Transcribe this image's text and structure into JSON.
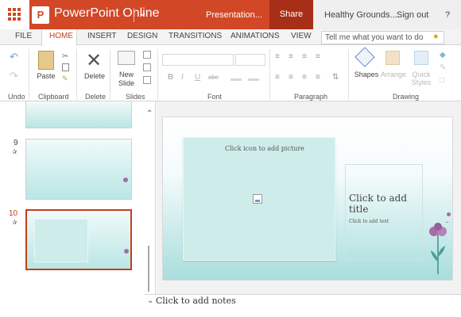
{
  "titlebar": {
    "app_title": "PowerPoint Online",
    "doc_name": "Presentation...",
    "share": "Share",
    "account": "Healthy Grounds...",
    "signout": "Sign out",
    "help": "?"
  },
  "tabs": [
    "FILE",
    "HOME",
    "INSERT",
    "DESIGN",
    "TRANSITIONS",
    "ANIMATIONS",
    "VIEW"
  ],
  "active_tab": "HOME",
  "tellme_placeholder": "Tell me what you want to do",
  "ribbon": {
    "undo_group": "Undo",
    "clipboard_group": "Clipboard",
    "paste": "Paste",
    "delete_group": "Delete",
    "delete": "Delete",
    "slides_group": "Slides",
    "new_slide_line1": "New",
    "new_slide_line2": "Slide",
    "font_group": "Font",
    "font_bold": "B",
    "font_italic": "I",
    "font_underline": "U",
    "font_strike": "abc",
    "paragraph_group": "Paragraph",
    "shapes": "Shapes",
    "arrange": "Arrange",
    "quick_styles_line1": "Quick",
    "quick_styles_line2": "Styles",
    "drawing_group": "Drawing"
  },
  "thumbnails": [
    {
      "number": "9",
      "selected": false
    },
    {
      "number": "10",
      "selected": true
    }
  ],
  "slide": {
    "picture_placeholder": "Click icon to add picture",
    "title_placeholder": "Click to add title",
    "subtitle_placeholder": "Click to add text"
  },
  "notes_placeholder": "Click to add notes",
  "colors": {
    "accent": "#d24726",
    "share_bg": "#a82f17",
    "slide_teal": "#bfe7e6",
    "selected_border": "#c43e1c"
  }
}
